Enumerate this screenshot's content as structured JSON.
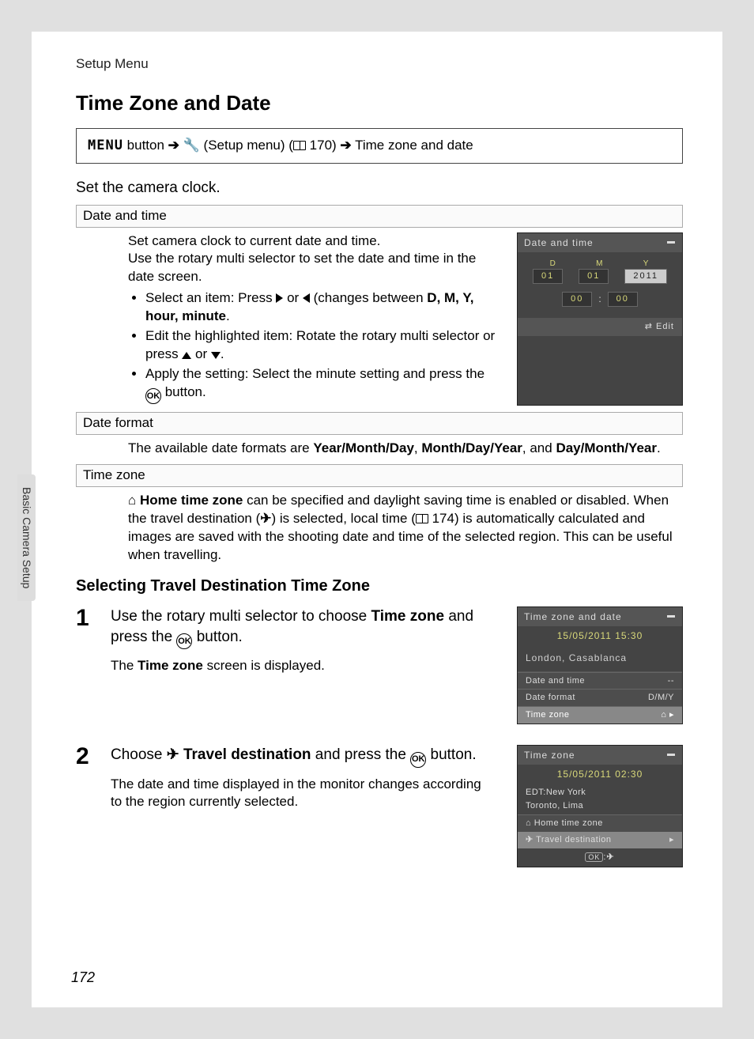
{
  "header": {
    "crumb": "Setup Menu",
    "title": "Time Zone and Date"
  },
  "navpath": {
    "menu": "MENU",
    "p1": " button ",
    "p2": " (Setup menu) (",
    "pageref": " 170) ",
    "tail": " Time zone and date"
  },
  "intro": "Set the camera clock.",
  "sub1": {
    "title": "Date and time",
    "l1": "Set camera clock to current date and time.",
    "l2": "Use the rotary multi selector to set the date and time in the date screen.",
    "b1a": "Select an item: Press ",
    "b1b": " or ",
    "b1c": " (changes between ",
    "b1_items": "D, M, Y, hour, minute",
    "b1d": ".",
    "b2a": "Edit the highlighted item: Rotate the rotary multi selector or press ",
    "b2b": " or ",
    "b2c": ".",
    "b3a": "Apply the setting: Select the minute setting and press the ",
    "b3b": " button."
  },
  "lcd1": {
    "title": "Date and time",
    "dmy": {
      "d": "D",
      "m": "M",
      "y": "Y"
    },
    "vals": {
      "d": "01",
      "m": "01",
      "y": "2011",
      "hh": "00",
      "mm": "00"
    },
    "edit": "Edit"
  },
  "sub2": {
    "title": "Date format",
    "body_a": "The available date formats are ",
    "opt1": "Year/Month/Day",
    "sep1": ", ",
    "opt2": "Month/Day/Year",
    "sep2": ", and ",
    "opt3": "Day/Month/Year",
    "tail": "."
  },
  "sub3": {
    "title": "Time zone",
    "bold": "Home time zone",
    "p1": " can be specified and daylight saving time is enabled or disabled. When the travel destination (",
    "p2": ") is selected, local time (",
    "pageref": " 174) is automatically calculated and images are saved with the shooting date and time of the selected region. This can be useful when travelling."
  },
  "h2": "Selecting Travel Destination Time Zone",
  "step1": {
    "num": "1",
    "lead_a": "Use the rotary multi selector to choose ",
    "lead_b": "Time zone",
    "lead_c": " and press the ",
    "lead_d": " button.",
    "after_a": "The ",
    "after_b": "Time zone",
    "after_c": " screen is displayed."
  },
  "lcd2": {
    "title": "Time zone and date",
    "datetime": "15/05/2011 15:30",
    "city": "London, Casablanca",
    "rows": {
      "r1": {
        "label": "Date and time",
        "val": "--"
      },
      "r2": {
        "label": "Date format",
        "val": "D/M/Y"
      },
      "r3": {
        "label": "Time zone",
        "val": "⌂"
      }
    }
  },
  "step2": {
    "num": "2",
    "lead_a": "Choose ",
    "lead_b": "Travel destination",
    "lead_c": " and press the ",
    "lead_d": " button.",
    "after": "The date and time displayed in the monitor changes according to the region currently selected."
  },
  "lcd3": {
    "title": "Time zone",
    "datetime": "15/05/2011 02:30",
    "city1": "EDT:New York",
    "city2": "Toronto, Lima",
    "home": "Home time zone",
    "travel": "Travel destination",
    "foot": "✈"
  },
  "ok_label": "OK",
  "side_tab": "Basic Camera Setup",
  "page_number": "172"
}
